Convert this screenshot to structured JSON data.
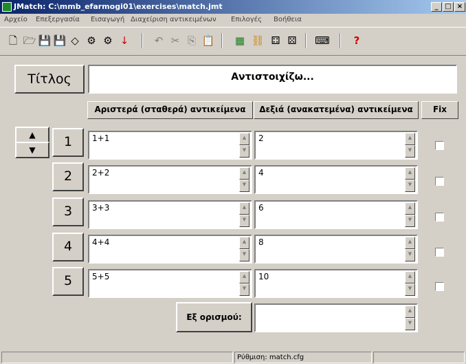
{
  "window": {
    "title": "JMatch: C:\\mmb_efarmogi01\\exercises\\match.jmt"
  },
  "caption_buttons": {
    "minimize": "_",
    "maximize": "□",
    "close": "×"
  },
  "menu": [
    "Αρχείο",
    "Επεξεργασία",
    "Εισαγωγή",
    "Διαχείριση αντικειμένων",
    "Επιλογές",
    "Βοήθεια"
  ],
  "toolbar": [
    "new-icon",
    "open-icon",
    "save-icon",
    "save-as-icon",
    "clear-icon",
    "web-page-icon",
    "web-page-2-icon",
    "export-icon",
    "undo-icon",
    "cut-icon",
    "copy-icon",
    "paste-icon",
    "image-icon",
    "link-icon",
    "match-config-icon",
    "config-icon",
    "keyboard-icon",
    "help-icon"
  ],
  "title_button": "Τίτλος",
  "title_value": "Αντιστοιχίζω...",
  "headers": {
    "left": "Αριστερά (σταθερά) αντικείμενα",
    "right": "Δεξιά (ανακατεμένα) αντικείμενα",
    "fix": "Fix"
  },
  "rows": [
    {
      "number": "1",
      "left": "1+1",
      "right": "2",
      "fixed": false
    },
    {
      "number": "2",
      "left": "2+2",
      "right": "4",
      "fixed": false
    },
    {
      "number": "3",
      "left": "3+3",
      "right": "6",
      "fixed": false
    },
    {
      "number": "4",
      "left": "4+4",
      "right": "8",
      "fixed": false
    },
    {
      "number": "5",
      "left": "5+5",
      "right": "10",
      "fixed": false
    }
  ],
  "default_label": "Εξ ορισμού:",
  "default_value": "",
  "statusbar": {
    "panel1": "",
    "panel2": "Ρύθμιση: match.cfg",
    "panel3": ""
  },
  "colors": {
    "titlebar_start": "#0a246a",
    "titlebar_end": "#a6caf0",
    "face": "#d4d0c8"
  }
}
